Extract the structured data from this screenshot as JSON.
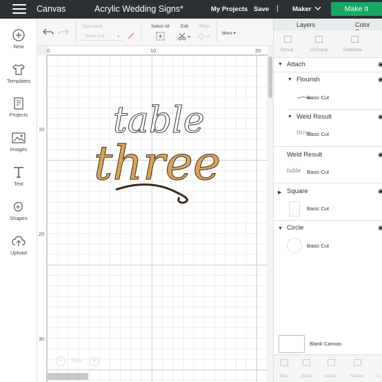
{
  "header": {
    "app_title": "Canvas",
    "project_title": "Acrylic Wedding Signs*",
    "my_projects": "My Projects",
    "save": "Save",
    "separator": "|",
    "machine": "Maker",
    "make_it": "Make It",
    "make_it_color": "#1aa764"
  },
  "sidebar": {
    "items": [
      {
        "label": "New",
        "icon": "plus-circle-icon"
      },
      {
        "label": "Templates",
        "icon": "shirt-icon"
      },
      {
        "label": "Projects",
        "icon": "projects-icon"
      },
      {
        "label": "Images",
        "icon": "image-icon"
      },
      {
        "label": "Text",
        "icon": "text-icon"
      },
      {
        "label": "Shapes",
        "icon": "shapes-icon"
      },
      {
        "label": "Upload",
        "icon": "upload-icon"
      }
    ]
  },
  "toolbar": {
    "operation_label": "Operation",
    "operation_value": "Basic Cut",
    "select_all": "Select All",
    "edit": "Edit",
    "offset": "Offset",
    "more": "More"
  },
  "canvas": {
    "ruler_top": [
      "0",
      "10",
      "20"
    ],
    "ruler_left": [
      "10",
      "20",
      "30"
    ],
    "zoom": "75%",
    "text_top": "table",
    "text_main": "three",
    "accent": "#d9a35c"
  },
  "panel": {
    "tabs": [
      "Layers",
      "Color Sync"
    ],
    "actions": [
      "Group",
      "UnGroup",
      "Duplicate"
    ],
    "layers": {
      "attach": "Attach",
      "flourish": "Flourish",
      "flourish_sub": "Basic Cut",
      "weld_result_1": "Weld Result",
      "weld_result_1_sub": "Basic Cut",
      "weld_result_1_thumb": "three",
      "weld_result_2": "Weld Result",
      "weld_result_2_sub": "Basic Cut",
      "weld_result_2_thumb": "table",
      "square": "Square",
      "square_sub": "Basic Cut",
      "circle": "Circle",
      "circle_sub": "Basic Cut"
    },
    "blank_canvas": "Blank Canvas",
    "bottom_actions": [
      "Slice",
      "Weld",
      "Attach",
      "Flatten",
      "C"
    ]
  }
}
